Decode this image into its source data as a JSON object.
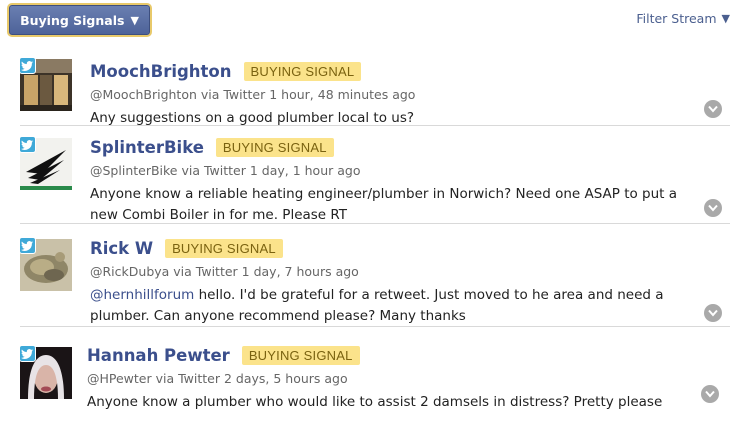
{
  "toolbar": {
    "stream_button_label": "Buying Signals",
    "filter_label": "Filter Stream"
  },
  "colors": {
    "accent": "#4e6399",
    "badge_bg": "#fbe38b",
    "name": "#3b4f8c",
    "twitter": "#3fa9d8"
  },
  "posts": [
    {
      "name": "MoochBrighton",
      "badge": "BUYING SIGNAL",
      "meta": "@MoochBrighton via Twitter 1 hour, 48 minutes ago",
      "text": "Any suggestions on a good plumber local to us?",
      "source_icon": "twitter-icon"
    },
    {
      "name": "SplinterBike",
      "badge": "BUYING SIGNAL",
      "meta": "@SplinterBike via Twitter 1 day, 1 hour ago",
      "text": "Anyone know a reliable heating engineer/plumber in Norwich? Need one ASAP to put a new Combi Boiler in for me. Please RT",
      "source_icon": "twitter-icon"
    },
    {
      "name": "Rick W",
      "badge": "BUYING SIGNAL",
      "meta": "@RickDubya via Twitter 1 day, 7 hours ago",
      "mention": "@hernhillforum",
      "text": " hello. I'd be grateful for a retweet. Just moved to he area and need a plumber. Can anyone recommend please? Many thanks",
      "source_icon": "twitter-icon"
    },
    {
      "name": "Hannah Pewter",
      "badge": "BUYING SIGNAL",
      "meta": "@HPewter via Twitter 2 days, 5 hours ago",
      "text": "Anyone know a plumber who would like to assist 2 damsels in distress? Pretty please",
      "source_icon": "twitter-icon"
    }
  ]
}
